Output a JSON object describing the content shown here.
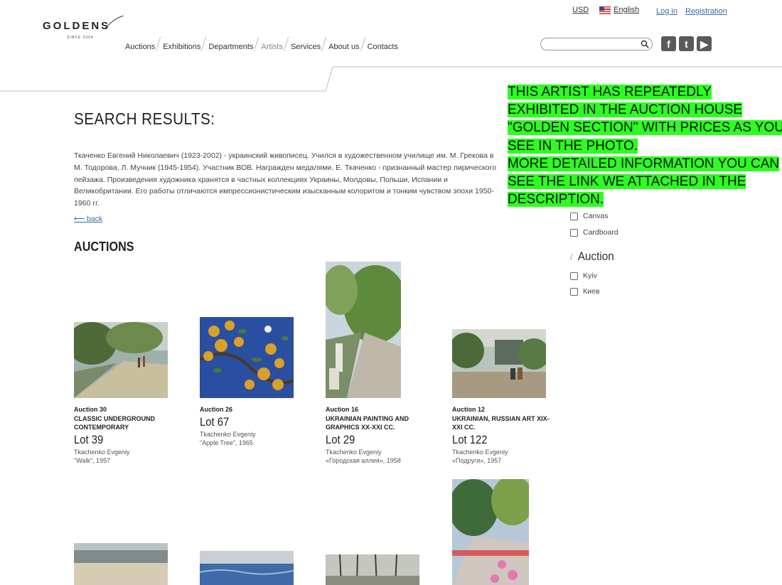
{
  "header": {
    "logo": "GOLDENS",
    "logo_sub": "SINCE 2004",
    "currency": "USD",
    "language": "English",
    "login": "Log in",
    "registration": "Registration",
    "nav": [
      "Auctions",
      "Exhibitions",
      "Departments",
      "Artists",
      "Services",
      "About us",
      "Contacts"
    ],
    "social": [
      "f",
      "t",
      "▶"
    ]
  },
  "page": {
    "title": "SEARCH RESULTS:",
    "bio": "Ткаченко Евгений Николаевич (1923-2002) - украинский живописец. Учился в художественном училище им. М. Грекова в М. Тодорова, Л. Мучник (1945-1954). Участник ВОВ. Награжден медалями. Е. Ткаченко - признанный мастер лирического пейзажа. Произведения художника хранятся в частных коллекциях Украины, Молдовы, Польши, Испании и Великобритании. Его работы отличаются импрессионистическим изысканным колоритом и тонким чувством эпохи 1950-1960 гг.",
    "back": "⟵ back",
    "auctions_title": "AUCTIONS"
  },
  "cards": [
    {
      "auction": "Auction 30",
      "title": "CLASSIC UNDERGROUND CONTEMPORARY",
      "lot": "Lot 39",
      "artist": "Tkachenko Evgeniy",
      "work": "\"Walk\", 1957"
    },
    {
      "auction": "Auction 26",
      "title": "",
      "lot": "Lot 67",
      "artist": "Tkachenko Evgeniy",
      "work": "\"Apple Tree\", 1965"
    },
    {
      "auction": "Auction 16",
      "title": "UKRAINIAN PAINTING AND GRAPHICS XX-XXI CC.",
      "lot": "Lot 29",
      "artist": "Tkachenko Evgeniy",
      "work": "«Городская аллея», 1958"
    },
    {
      "auction": "Auction 12",
      "title": "UKRAINIAN, RUSSIAN ART XIX-XXI CC.",
      "lot": "Lot 122",
      "artist": "Tkachenko Evgeniy",
      "work": "«Подруги», 1957"
    }
  ],
  "filters": {
    "material_partial": "Canvas",
    "material": [
      "Cardboard"
    ],
    "auction_heading": "Auction",
    "auction": [
      "Kyiv",
      "Киев"
    ]
  },
  "overlay": {
    "line1": "THIS ARTIST HAS REPEATEDLY EXHIBITED IN THE AUCTION HOUSE \"GOLDEN SECTION\" WITH PRICES AS YOU SEE IN THE PHOTO.",
    "line2": "MORE DETAILED INFORMATION YOU CAN SEE THE LINK WE ATTACHED IN THE DESCRIPTION."
  },
  "colors": {
    "overlay_bg": "#2bff1f",
    "link": "#3a6aa0",
    "social": "#5a5a5a"
  }
}
